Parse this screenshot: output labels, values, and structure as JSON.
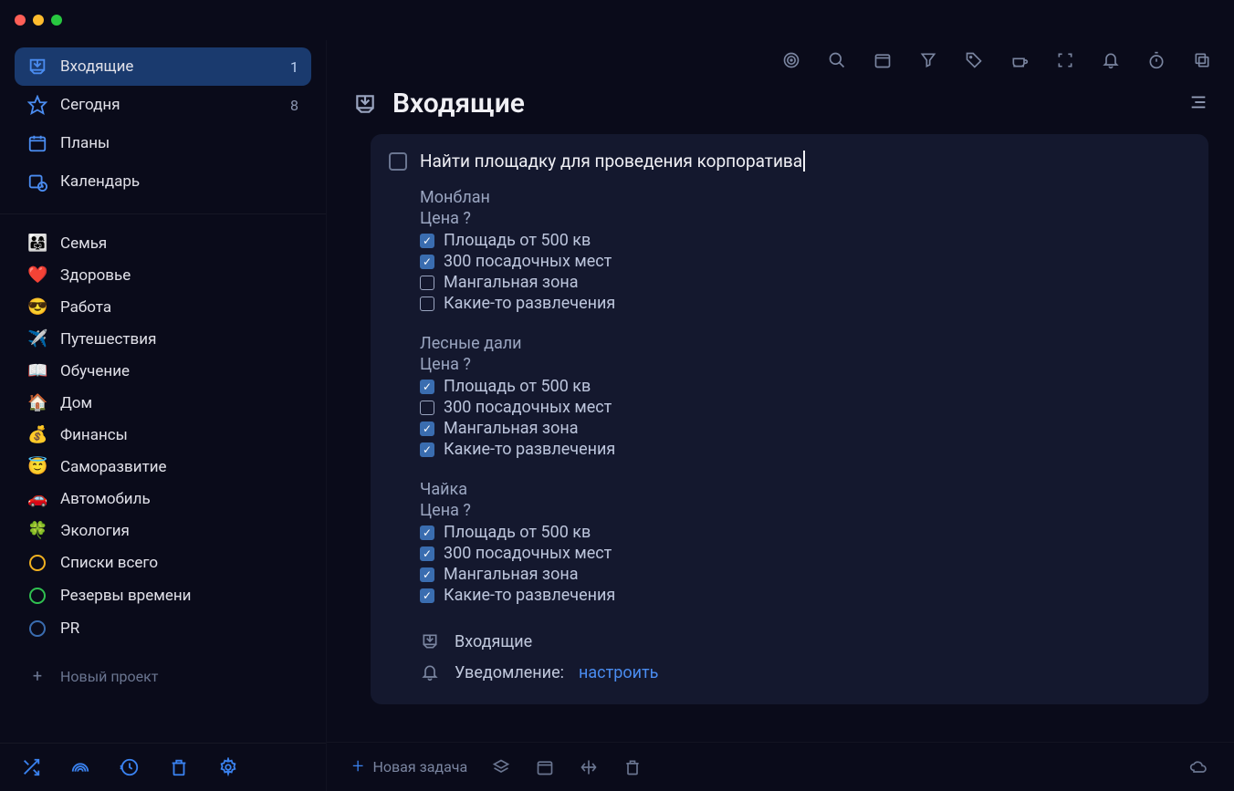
{
  "sidebar": {
    "nav": [
      {
        "id": "inbox",
        "label": "Входящие",
        "count": "1",
        "active": true
      },
      {
        "id": "today",
        "label": "Сегодня",
        "count": "8",
        "active": false
      },
      {
        "id": "plans",
        "label": "Планы",
        "count": "",
        "active": false
      },
      {
        "id": "calendar",
        "label": "Календарь",
        "count": "",
        "active": false
      }
    ],
    "projects": [
      {
        "emoji": "👨‍👩‍👧",
        "label": "Семья"
      },
      {
        "emoji": "❤️",
        "label": "Здоровье"
      },
      {
        "emoji": "😎",
        "label": "Работа"
      },
      {
        "emoji": "✈️",
        "label": "Путешествия"
      },
      {
        "emoji": "📖",
        "label": "Обучение"
      },
      {
        "emoji": "🏠",
        "label": "Дом"
      },
      {
        "emoji": "💰",
        "label": "Финансы"
      },
      {
        "emoji": "😇",
        "label": "Саморазвитие"
      },
      {
        "emoji": "🚗",
        "label": "Автомобиль"
      },
      {
        "emoji": "🍀",
        "label": "Экология"
      },
      {
        "emoji": "",
        "circle": "#f0b020",
        "label": "Списки всего"
      },
      {
        "emoji": "",
        "circle": "#30c050",
        "label": "Резервы времени"
      },
      {
        "emoji": "",
        "circle": "#3a6db0",
        "label": "PR"
      }
    ],
    "new_project": "Новый проект"
  },
  "page": {
    "title": "Входящие"
  },
  "task": {
    "title": "Найти площадку для проведения корпоратива",
    "venues": [
      {
        "name": "Монблан",
        "price": "Цена ?",
        "checks": [
          {
            "checked": true,
            "label": "Площадь от 500 кв"
          },
          {
            "checked": true,
            "label": "300 посадочных мест"
          },
          {
            "checked": false,
            "label": "Мангальная зона"
          },
          {
            "checked": false,
            "label": "Какие-то развлечения"
          }
        ]
      },
      {
        "name": "Лесные дали",
        "price": "Цена ?",
        "checks": [
          {
            "checked": true,
            "label": "Площадь от 500 кв"
          },
          {
            "checked": false,
            "label": "300 посадочных мест"
          },
          {
            "checked": true,
            "label": "Мангальная зона"
          },
          {
            "checked": true,
            "label": "Какие-то развлечения"
          }
        ]
      },
      {
        "name": "Чайка",
        "price": "Цена ?",
        "checks": [
          {
            "checked": true,
            "label": "Площадь от 500 кв"
          },
          {
            "checked": true,
            "label": "300 посадочных мест"
          },
          {
            "checked": true,
            "label": "Мангальная зона"
          },
          {
            "checked": true,
            "label": "Какие-то развлечения"
          }
        ]
      }
    ],
    "meta": {
      "list_label": "Входящие",
      "notification_label": "Уведомление:",
      "notification_link": "настроить"
    }
  },
  "bottombar": {
    "new_task": "Новая задача"
  }
}
